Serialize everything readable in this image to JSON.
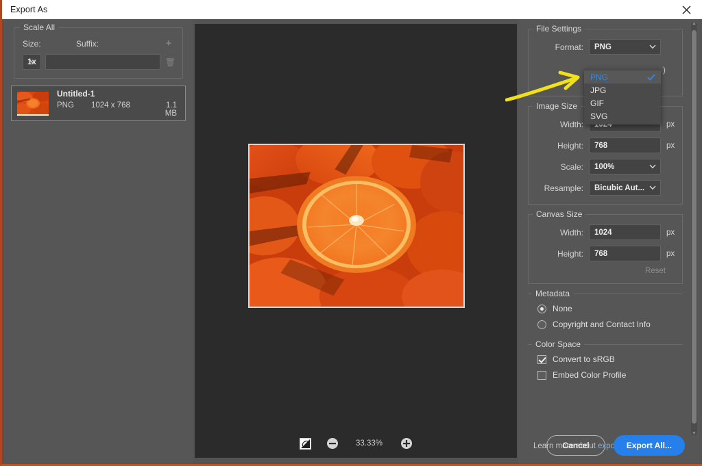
{
  "window": {
    "title": "Export As",
    "close_icon": "close-icon"
  },
  "sidebar": {
    "scale_all": {
      "group_title": "Scale All",
      "size_label": "Size:",
      "suffix_label": "Suffix:",
      "add_icon": "plus-icon",
      "delete_icon": "trash-icon",
      "size_value": "1x",
      "suffix_value": "",
      "suffix_placeholder": ""
    },
    "file_item": {
      "name": "Untitled-1",
      "format": "PNG",
      "dimensions": "1024 x 768",
      "filesize": "1.1 MB"
    }
  },
  "preview": {
    "zoom_level": "33.33%",
    "fit_icon": "toggle-transparency-icon",
    "zoom_out_icon": "minus-circle-icon",
    "zoom_in_icon": "plus-circle-icon",
    "image_alt": "sliced oranges close-up"
  },
  "settings": {
    "file_settings": {
      "group_title": "File Settings",
      "format_label": "Format:",
      "format_value": "PNG",
      "hidden_text": ")"
    },
    "format_dropdown": {
      "open": true,
      "options": [
        {
          "label": "PNG",
          "selected": true
        },
        {
          "label": "JPG",
          "selected": false
        },
        {
          "label": "GIF",
          "selected": false
        },
        {
          "label": "SVG",
          "selected": false
        }
      ],
      "check_icon": "checkmark-icon",
      "accent_color": "#2f89e8"
    },
    "image_size": {
      "group_title": "Image Size",
      "width_label": "Width:",
      "width_value": "1024",
      "width_unit": "px",
      "height_label": "Height:",
      "height_value": "768",
      "height_unit": "px",
      "scale_label": "Scale:",
      "scale_value": "100%",
      "resample_label": "Resample:",
      "resample_value": "Bicubic Aut..."
    },
    "canvas_size": {
      "group_title": "Canvas Size",
      "width_label": "Width:",
      "width_value": "1024",
      "width_unit": "px",
      "height_label": "Height:",
      "height_value": "768",
      "height_unit": "px",
      "reset_label": "Reset"
    },
    "metadata": {
      "group_title": "Metadata",
      "options": [
        {
          "label": "None",
          "selected": true
        },
        {
          "label": "Copyright and Contact Info",
          "selected": false
        }
      ]
    },
    "color_space": {
      "group_title": "Color Space",
      "options": [
        {
          "label": "Convert to sRGB",
          "checked": true
        },
        {
          "label": "Embed Color Profile",
          "checked": false
        }
      ]
    },
    "learn_more": {
      "text": "Learn more about",
      "link": "export options"
    }
  },
  "footer": {
    "cancel_label": "Cancel",
    "export_label": "Export All...",
    "export_color": "#2680eb"
  },
  "annotation": {
    "arrow_color": "#f2e119",
    "type": "arrow-pointing-right"
  }
}
